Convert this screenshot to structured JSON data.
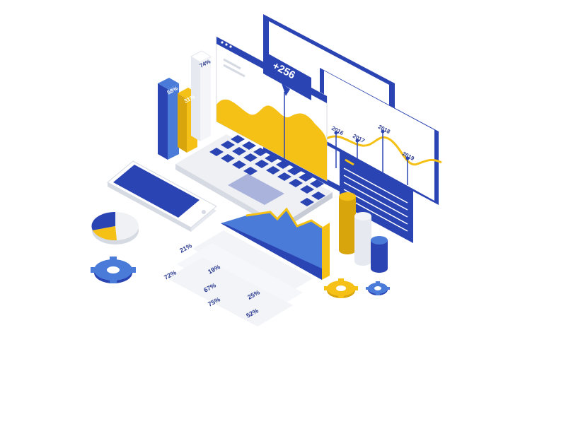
{
  "colors": {
    "blue": "#2b44b3",
    "blue_mid": "#4a7bd8",
    "blue_light": "#5b8ee6",
    "yellow": "#f5c116",
    "yellow_dark": "#d9a50d",
    "gray_light": "#eef0f4",
    "gray": "#d6dae2",
    "navy_text": "#2a3a8f"
  },
  "badge": {
    "value": "+256"
  },
  "bar_labels": {
    "blue": "58%",
    "yellow": "31%",
    "white": "74%"
  },
  "timeline": {
    "years": [
      "2016",
      "2017",
      "2018",
      "2019"
    ]
  },
  "percent_list": {
    "col1": [
      "21%",
      "72%"
    ],
    "col2": [
      "19%",
      "67%",
      "75%"
    ],
    "col3": [
      "25%",
      "52%"
    ]
  },
  "icons": [
    "gear-icon",
    "pie-chart-icon",
    "smartphone-icon",
    "laptop-icon",
    "cylinder-chart-icon"
  ]
}
